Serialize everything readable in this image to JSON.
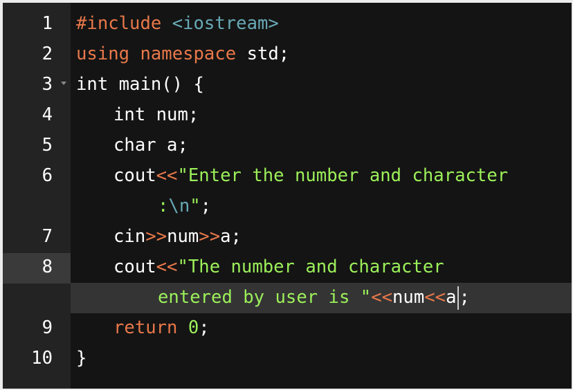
{
  "editor": {
    "line_numbers": [
      "1",
      "2",
      "3",
      "4",
      "5",
      "6",
      "7",
      "8",
      "9",
      "10"
    ],
    "active_line": "8",
    "lines": {
      "l1": {
        "directive": "#include",
        "header": "<iostream>"
      },
      "l2": {
        "kw_using": "using",
        "kw_namespace": "namespace",
        "rest": " std;"
      },
      "l3": {
        "text": "int main() {"
      },
      "l4": {
        "text": "int num;"
      },
      "l5": {
        "text": "char a;"
      },
      "l6": {
        "cout": "cout",
        "op": "<<",
        "str": "\"Enter the number and character",
        "str_cont": ":",
        "esc": "\\n",
        "str_end": "\"",
        "semi": ";"
      },
      "l7": {
        "cin": "cin",
        "op1": ">>",
        "v1": "num",
        "op2": ">>",
        "v2": "a",
        "semi": ";"
      },
      "l8": {
        "cout": "cout",
        "op": "<<",
        "str": "\"The number and character",
        "str_cont": "entered by user is \"",
        "op2": "<<",
        "v1": "num",
        "op3": "<<",
        "v2": "a",
        "semi": ";"
      },
      "l9": {
        "kw_return": "return",
        "num": "0",
        "semi": ";"
      },
      "l10": {
        "text": "}"
      }
    }
  },
  "colors": {
    "background": "#141414",
    "gutter": "#232323",
    "keyword": "#e8784a",
    "string": "#9cf05a",
    "include": "#68a9b5",
    "active_line": "#343434"
  },
  "icons": {
    "fold_marker": "fold-arrow-icon"
  }
}
